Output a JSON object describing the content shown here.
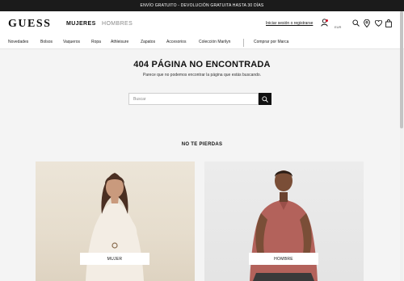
{
  "promo_bar": {
    "text": "ENVÍO GRATUITO - DEVOLUCIÓN GRATUITA HASTA 30 DÍAS"
  },
  "header": {
    "logo": "GUESS",
    "tabs": [
      {
        "label": "MUJERES",
        "active": true
      },
      {
        "label": "HOMBRES",
        "active": false
      }
    ],
    "login_label": "Iniciar sesión o registrarse",
    "currency": "EUR",
    "icons": [
      "user-icon",
      "search-icon",
      "location-icon",
      "heart-icon",
      "bag-icon"
    ]
  },
  "nav": {
    "items": [
      "Novedades",
      "Bolsos",
      "Vaqueros",
      "Ropa",
      "Athleisure",
      "Zapatos",
      "Accesorios",
      "Colección Marilyn"
    ],
    "shop_by_brand": "Comprar por Marca"
  },
  "error": {
    "title": "404 PÁGINA NO ENCONTRADA",
    "message": "Parece que no podemos encontrar la página que estás buscando."
  },
  "search": {
    "placeholder": "Buscar",
    "value": ""
  },
  "dont_miss": {
    "heading": "NO TE PIERDAS",
    "cards": [
      {
        "label": "MUJER"
      },
      {
        "label": "HOMBRE"
      }
    ]
  },
  "colors": {
    "promo_bar_bg": "#1b1b1b",
    "page_bg": "#f4f4f4",
    "accent_dot": "#d3122b",
    "search_button_bg": "#111111"
  }
}
